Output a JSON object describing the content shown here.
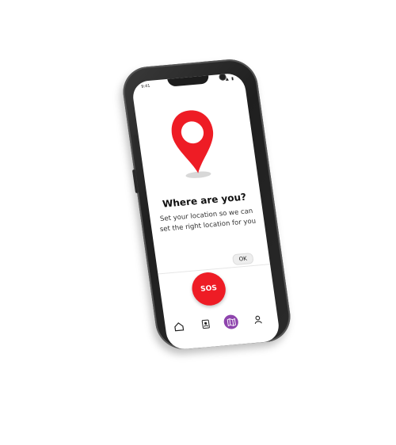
{
  "status_bar": {
    "time": "9:41",
    "icons": "▲ ▮"
  },
  "location_prompt": {
    "title": "Where are you?",
    "message": "Set your location so we can set the right location for you",
    "ok_label": "OK"
  },
  "sos_button": {
    "label": "SOS"
  },
  "bottom_nav": {
    "items": [
      {
        "icon": "home-icon"
      },
      {
        "icon": "contacts-icon"
      },
      {
        "icon": "map-icon",
        "active": true
      },
      {
        "icon": "profile-icon"
      }
    ]
  },
  "colors": {
    "accent": "#ee1c25",
    "active_nav": "#8e44ad"
  }
}
